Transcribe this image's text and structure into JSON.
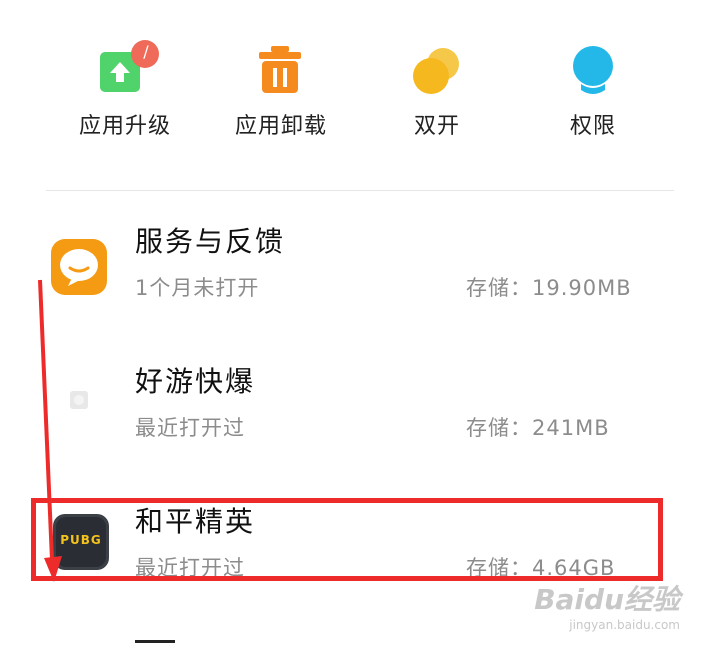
{
  "actions": [
    {
      "label": "应用升级",
      "icon": "app-upgrade-icon",
      "badge": "/"
    },
    {
      "label": "应用卸载",
      "icon": "trash-icon"
    },
    {
      "label": "双开",
      "icon": "dual-circles-icon"
    },
    {
      "label": "权限",
      "icon": "permission-icon"
    }
  ],
  "apps": [
    {
      "name": "服务与反馈",
      "status": "1个月未打开",
      "storage": "存储：19.90MB",
      "icon": "feedback-chat-icon"
    },
    {
      "name": "好游快爆",
      "status": "最近打开过",
      "storage": "存储：241MB",
      "icon": "placeholder-app-icon"
    },
    {
      "name": "和平精英",
      "status": "最近打开过",
      "storage": "存储：4.64GB",
      "icon": "pubg-icon",
      "icon_text": "PUBG"
    }
  ],
  "colors": {
    "upgrade_green": "#4fd36a",
    "badge_red": "#f06a5a",
    "trash_orange": "#f58a1f",
    "dual_yellow": "#f6b81f",
    "permission_cyan": "#23b8e8",
    "feedback_orange": "#f59a13",
    "highlight_red": "#ee2b2b"
  },
  "watermark": {
    "main": "Baidu经验",
    "sub": "jingyan.baidu.com"
  }
}
